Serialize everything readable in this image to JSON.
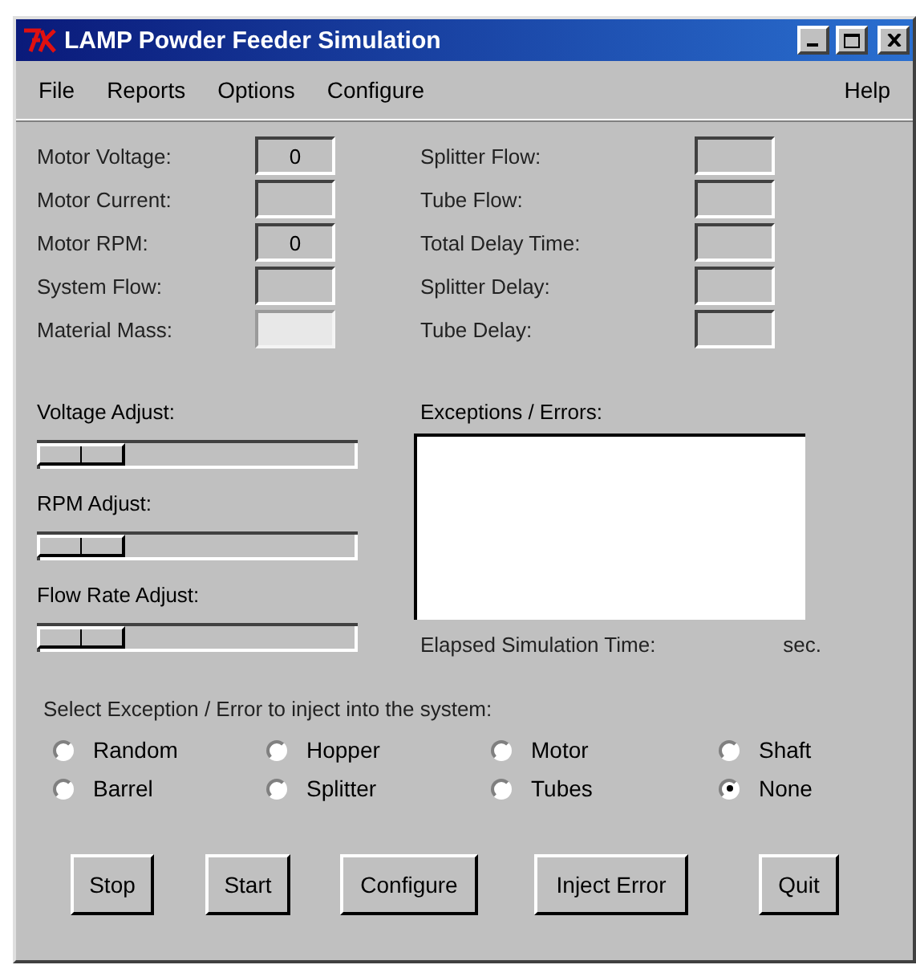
{
  "window": {
    "title": "LAMP Powder Feeder Simulation"
  },
  "menu": {
    "left": [
      "File",
      "Reports",
      "Options",
      "Configure"
    ],
    "right": [
      "Help"
    ]
  },
  "readouts_left": [
    {
      "label": "Motor Voltage:",
      "value": "0",
      "disabled": false
    },
    {
      "label": "Motor Current:",
      "disabled": false
    },
    {
      "label": "Motor RPM:",
      "value": "0",
      "disabled": false
    },
    {
      "label": "System Flow:",
      "disabled": false
    },
    {
      "label": "Material Mass:",
      "disabled": true
    }
  ],
  "readouts_right": [
    {
      "label": "Splitter Flow:",
      "disabled": false
    },
    {
      "label": "Tube Flow:",
      "disabled": false
    },
    {
      "label": "Total Delay Time:",
      "disabled": false
    },
    {
      "label": "Splitter Delay:",
      "disabled": false
    },
    {
      "label": "Tube Delay:",
      "disabled": false
    }
  ],
  "sliders": [
    {
      "label": "Voltage Adjust:"
    },
    {
      "label": "RPM Adjust:"
    },
    {
      "label": "Flow Rate Adjust:"
    }
  ],
  "errors_box": {
    "label": "Exceptions / Errors:"
  },
  "elapsed": {
    "label": "Elapsed Simulation Time:",
    "unit": "sec."
  },
  "inject": {
    "label": "Select Exception / Error to inject into the system:",
    "options": [
      {
        "label": "Random",
        "selected": false
      },
      {
        "label": "Hopper",
        "selected": false
      },
      {
        "label": "Motor",
        "selected": false
      },
      {
        "label": "Shaft",
        "selected": false
      },
      {
        "label": "Barrel",
        "selected": false
      },
      {
        "label": "Splitter",
        "selected": false
      },
      {
        "label": "Tubes",
        "selected": false
      },
      {
        "label": "None",
        "selected": true
      }
    ]
  },
  "buttons": [
    "Stop",
    "Start",
    "Configure",
    "Inject Error",
    "Quit"
  ]
}
